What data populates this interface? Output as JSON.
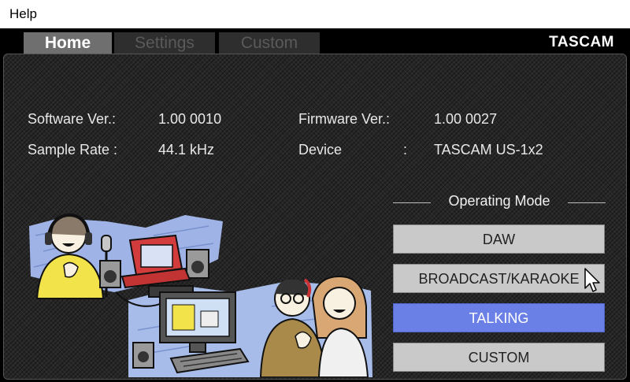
{
  "menubar": {
    "help_label": "Help"
  },
  "tabs": [
    {
      "label": "Home",
      "active": true
    },
    {
      "label": "Settings",
      "active": false
    },
    {
      "label": "Custom",
      "active": false
    }
  ],
  "brand": "TASCAM",
  "info": {
    "software_label": "Software Ver.:",
    "software_value": "1.00 0010",
    "sample_rate_label": "Sample Rate :",
    "sample_rate_value": "44.1 kHz",
    "firmware_label": "Firmware Ver.:",
    "firmware_value": "1.00 0027",
    "device_label": "Device",
    "device_colon": ":",
    "device_value": "TASCAM US-1x2"
  },
  "operating_mode": {
    "title": "Operating Mode",
    "buttons": [
      "DAW",
      "BROADCAST/KARAOKE",
      "TALKING",
      "CUSTOM"
    ],
    "selected": "TALKING"
  },
  "colors": {
    "selected_button": "#6b80e6",
    "button": "#c9c9c9",
    "tab_active": "#6f6f6f",
    "panel_bg": "#262626"
  }
}
